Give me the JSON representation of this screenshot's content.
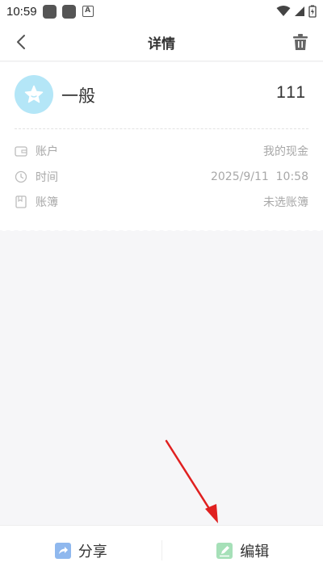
{
  "status_bar": {
    "time": "10:59"
  },
  "header": {
    "title": "详情"
  },
  "record": {
    "category": "一般",
    "amount": "111",
    "fields": [
      {
        "label": "账户",
        "value": "我的现金",
        "icon": "wallet-icon"
      },
      {
        "label": "时间",
        "value": "2025/9/11  10:58",
        "icon": "clock-icon"
      },
      {
        "label": "账簿",
        "value": "未选账簿",
        "icon": "book-icon"
      }
    ]
  },
  "bottom_bar": {
    "share_label": "分享",
    "edit_label": "编辑"
  },
  "colors": {
    "category_icon_bg": "#b4e6f7",
    "share_icon": "#8fb8ee",
    "edit_icon": "#a6e0b8",
    "annotation_arrow": "#e02020"
  }
}
